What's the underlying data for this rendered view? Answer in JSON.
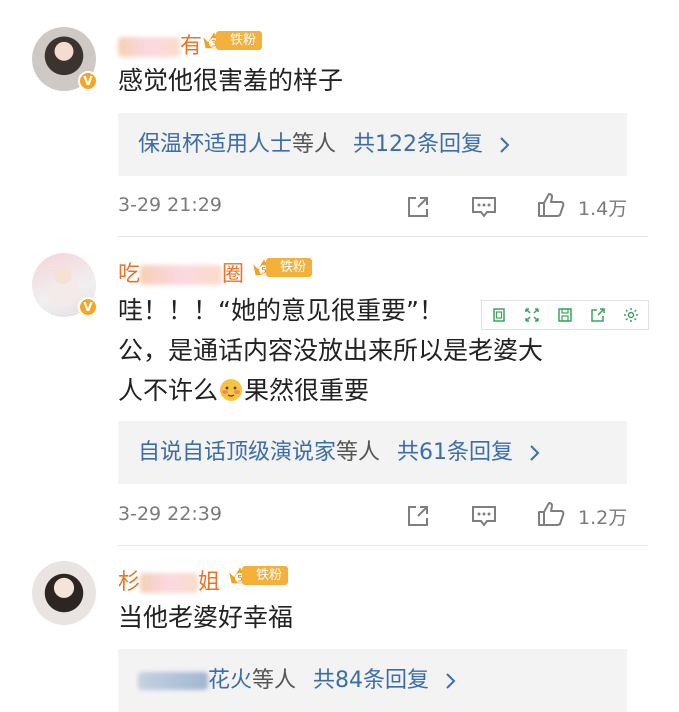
{
  "comments": [
    {
      "username_visible": "有",
      "badge": {
        "level": "3",
        "label": "铁粉"
      },
      "text": "感觉他很害羞的样子",
      "replies": {
        "names": "保温杯适用人士",
        "suffix": "等人",
        "count_text": "共122条回复"
      },
      "time": "3-29 21:29",
      "likes": "1.4万"
    },
    {
      "username_visible": "吃",
      "username_tail": "圈",
      "badge": {
        "level": "5",
        "label": "铁粉"
      },
      "text_line1": "哇！！！“她的意见很重要”！",
      "text_line2": "公，是通话内容没放出来所以是老婆大",
      "text_line3a": "人不许么",
      "text_line3b": "果然很重要",
      "replies": {
        "names": "自说自话顶级演说家",
        "suffix": "等人",
        "count_text": "共61条回复"
      },
      "time": "3-29 22:39",
      "likes": "1.2万"
    },
    {
      "username_visible": "杉",
      "username_tail": "姐",
      "badge": {
        "level": "5",
        "label": "铁粉"
      },
      "text": "当他老婆好幸福",
      "replies": {
        "names": "花火",
        "suffix": "等人",
        "count_text": "共84条回复"
      }
    }
  ],
  "icons": {
    "share": "share-icon",
    "comment": "comment-icon",
    "like": "thumbs-up-icon",
    "chevron": "chevron-right-icon",
    "verified": "verified-badge-icon",
    "emoji": "shy-emoji-icon"
  },
  "colors": {
    "username": "#e8742a",
    "link": "#3b6ea8",
    "badge": "#f3b13b",
    "verified": "#f5a623"
  }
}
